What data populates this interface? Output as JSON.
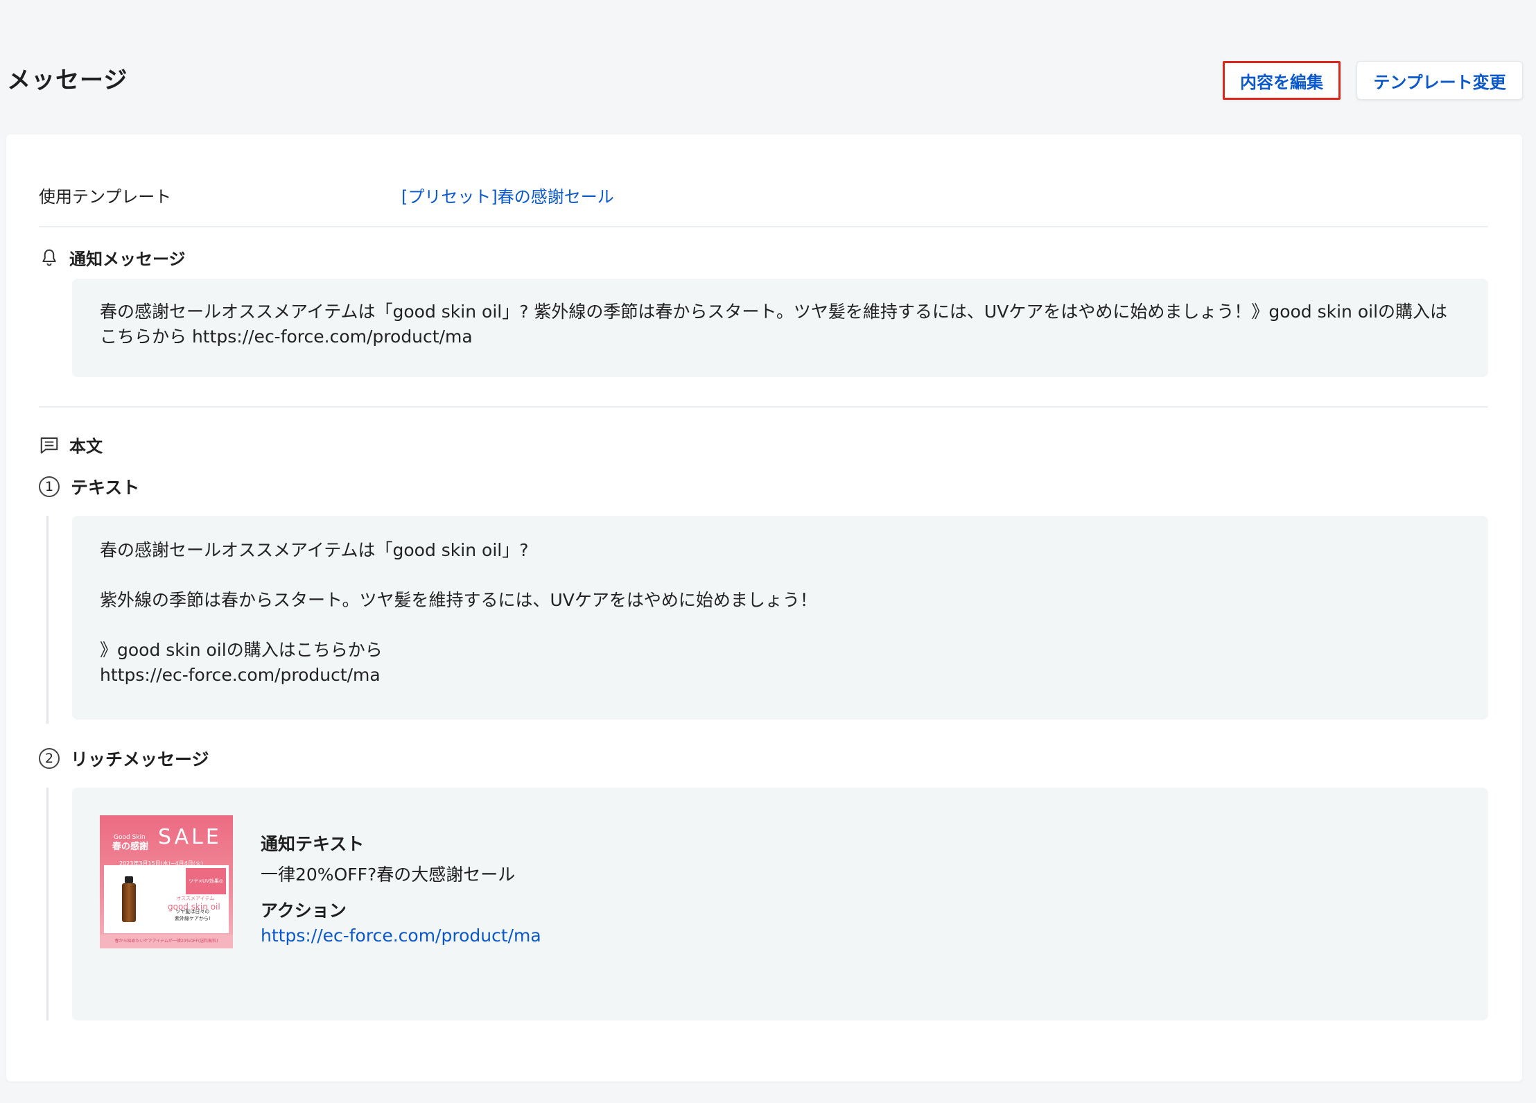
{
  "header": {
    "title": "メッセージ",
    "edit_button": "内容を編集",
    "template_button": "テンプレート変更"
  },
  "template_row": {
    "label": "使用テンプレート",
    "value": "[プリセット]春の感謝セール"
  },
  "notification": {
    "heading": "通知メッセージ",
    "icon": "bell-icon",
    "text": "春の感謝セールオススメアイテムは「good skin oil」? 紫外線の季節は春からスタート。ツヤ髪を維持するには、UVケアをはやめに始めましょう！》good skin oilの購入はこちらから https://ec-force.com/product/ma"
  },
  "body": {
    "heading": "本文",
    "icon": "message-icon",
    "steps": [
      {
        "number": "1",
        "label": "テキスト",
        "paragraphs": [
          "春の感謝セールオススメアイテムは「good skin oil」?",
          "紫外線の季節は春からスタート。ツヤ髪を維持するには、UVケアをはやめに始めましょう！",
          "》good skin oilの購入はこちらから\nhttps://ec-force.com/product/ma"
        ]
      },
      {
        "number": "2",
        "label": "リッチメッセージ",
        "image": {
          "brand": "Good Skin",
          "subtitle": "春の感謝",
          "sale": "SALE",
          "dates": "2023年3月15日(水)~4月4日(火)",
          "tag": "ツヤ×UV効果◎",
          "line1": "オススメアイテム",
          "product": "good skin oil",
          "line3": "ツヤ髪は日々の\n紫外線ケアから!",
          "footer": "春から始めたいケアアイテムが一律20%OFF(送料無料)"
        },
        "notify_label": "通知テキスト",
        "notify_value": "一律20%OFF?春の大感謝セール",
        "action_label": "アクション",
        "action_value": "https://ec-force.com/product/ma"
      }
    ]
  },
  "colors": {
    "accent": "#0a58c9",
    "highlight_border": "#d9281b",
    "box_bg": "#f3f6f7"
  }
}
